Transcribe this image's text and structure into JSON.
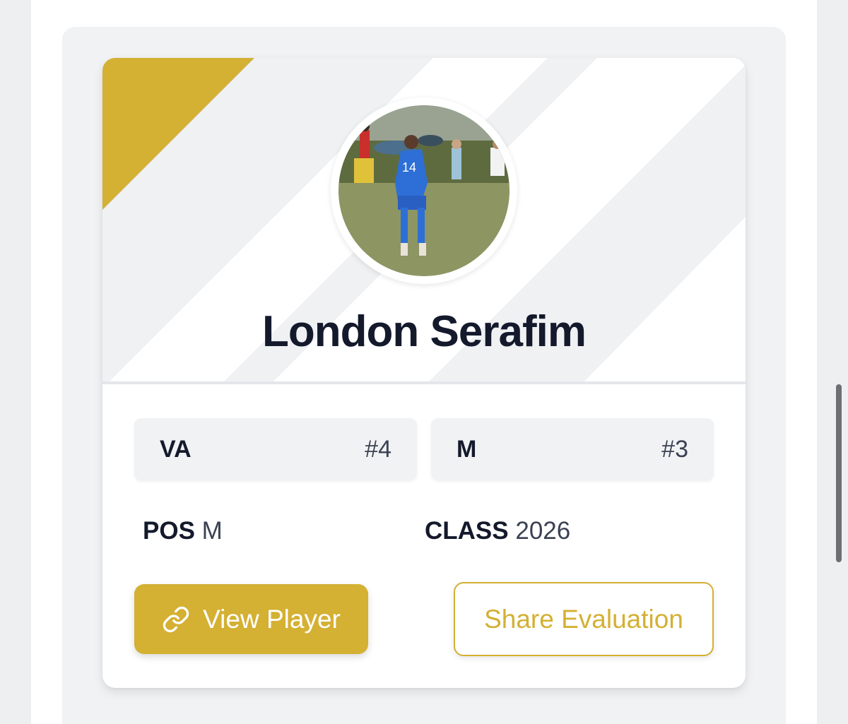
{
  "player": {
    "name": "London Serafim",
    "photo_alt": "Player photo",
    "jersey_number_in_photo": "14"
  },
  "rankings": [
    {
      "label": "VA",
      "rank": "#4"
    },
    {
      "label": "M",
      "rank": "#3"
    }
  ],
  "info": {
    "pos_label": "POS",
    "pos_value": "M",
    "class_label": "CLASS",
    "class_value": "2026"
  },
  "actions": {
    "view_label": "View Player",
    "view_icon": "link-icon",
    "share_label": "Share Evaluation"
  },
  "colors": {
    "accent_gold": "#d4b033",
    "text_dark": "#141a2c",
    "card_bg": "#f1f2f4"
  }
}
